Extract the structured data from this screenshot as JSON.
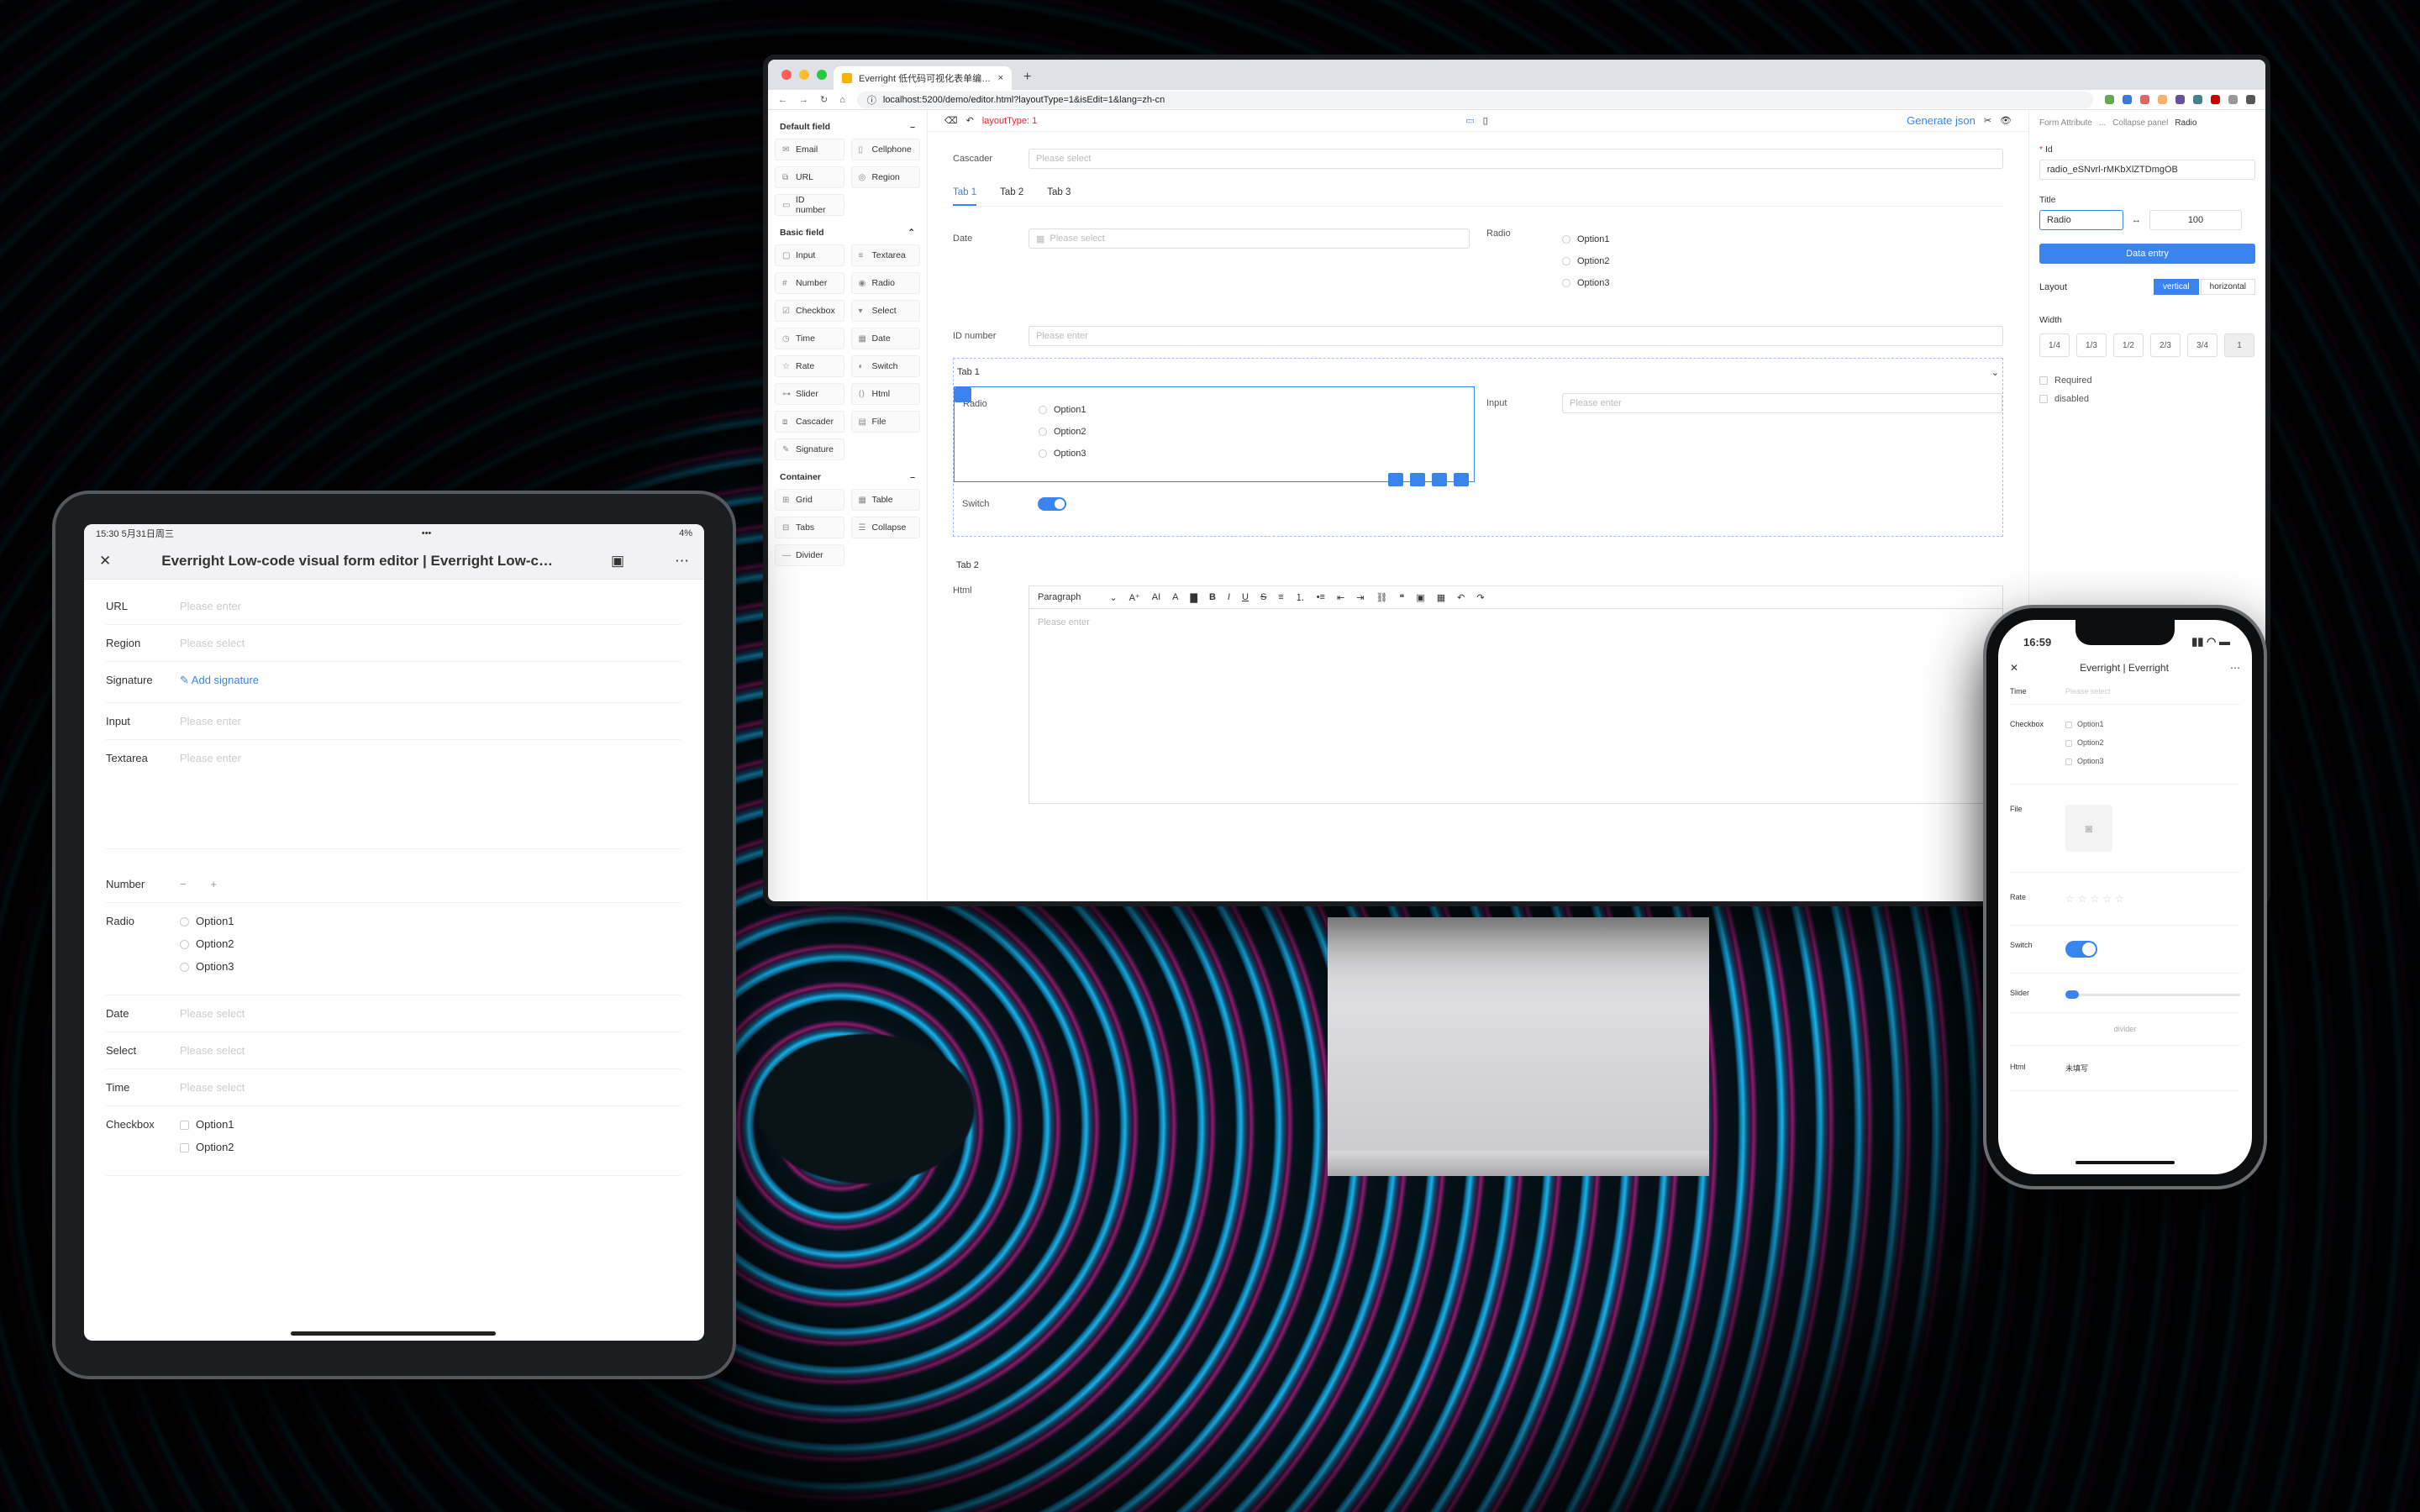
{
  "browser": {
    "tab_title": "Everright 低代码可视化表单编辑器",
    "tab_close": "×",
    "new_tab": "+",
    "url": "localhost:5200/demo/editor.html?layoutType=1&isEdit=1&lang=zh-cn"
  },
  "left_panel": {
    "groups": [
      {
        "title": "Default field",
        "items": [
          "Email",
          "Cellphone",
          "URL",
          "Region",
          "ID number"
        ]
      },
      {
        "title": "Basic field",
        "items": [
          "Input",
          "Textarea",
          "Number",
          "Radio",
          "Checkbox",
          "Select",
          "Time",
          "Date",
          "Rate",
          "Switch",
          "Slider",
          "Html",
          "Cascader",
          "File",
          "Signature"
        ]
      },
      {
        "title": "Container",
        "items": [
          "Grid",
          "Table",
          "Tabs",
          "Collapse",
          "Divider"
        ]
      }
    ]
  },
  "canvas": {
    "layout_type": "layoutType: 1",
    "generate_json": "Generate json",
    "cascader_label": "Cascader",
    "cascader_placeholder": "Please select",
    "tabs": [
      "Tab 1",
      "Tab 2",
      "Tab 3"
    ],
    "date_label": "Date",
    "date_placeholder": "Please select",
    "radio_label": "Radio",
    "options": [
      "Option1",
      "Option2",
      "Option3"
    ],
    "id_label": "ID number",
    "id_placeholder": "Please enter",
    "collapse1": "Tab 1",
    "collapse2": "Tab 2",
    "input_label": "Input",
    "input_placeholder": "Please enter",
    "switch_label": "Switch",
    "html_label": "Html",
    "paragraph": "Paragraph",
    "editor_placeholder": "Please enter"
  },
  "right_panel": {
    "breadcrumb": [
      "Form Attribute",
      "...",
      "Collapse panel",
      "Radio"
    ],
    "id_label": "Id",
    "id_value": "radio_eSNvrl-rMKbXlZTDmgOB",
    "title_label": "Title",
    "title_value": "Radio",
    "title_width": "100",
    "data_entry": "Data entry",
    "layout_label": "Layout",
    "layout_options": [
      "vertical",
      "horizontal"
    ],
    "width_label": "Width",
    "width_options": [
      "1/4",
      "1/3",
      "1/2",
      "2/3",
      "3/4",
      "1"
    ],
    "required": "Required",
    "disabled": "disabled"
  },
  "ipad": {
    "time": "15:30 5月31日周三",
    "battery": "4%",
    "title": "Everright Low-code visual form editor | Everright Low-code visual fo",
    "fields": {
      "url": "URL",
      "region": "Region",
      "signature": "Signature",
      "input": "Input",
      "textarea": "Textarea",
      "number": "Number",
      "radio": "Radio",
      "date": "Date",
      "select": "Select",
      "time": "Time",
      "checkbox": "Checkbox"
    },
    "please_enter": "Please enter",
    "please_select": "Please select",
    "add_signature": "Add signature",
    "options": [
      "Option1",
      "Option2",
      "Option3"
    ]
  },
  "phone": {
    "time": "16:59",
    "title": "Everright | Everright",
    "fields": {
      "time": "Time",
      "checkbox": "Checkbox",
      "file": "File",
      "rate": "Rate",
      "switch": "Switch",
      "slider": "Slider",
      "html": "Html"
    },
    "time_placeholder": "Please select",
    "options": [
      "Option1",
      "Option2",
      "Option3"
    ],
    "divider": "divider",
    "html_value": "未填写"
  }
}
